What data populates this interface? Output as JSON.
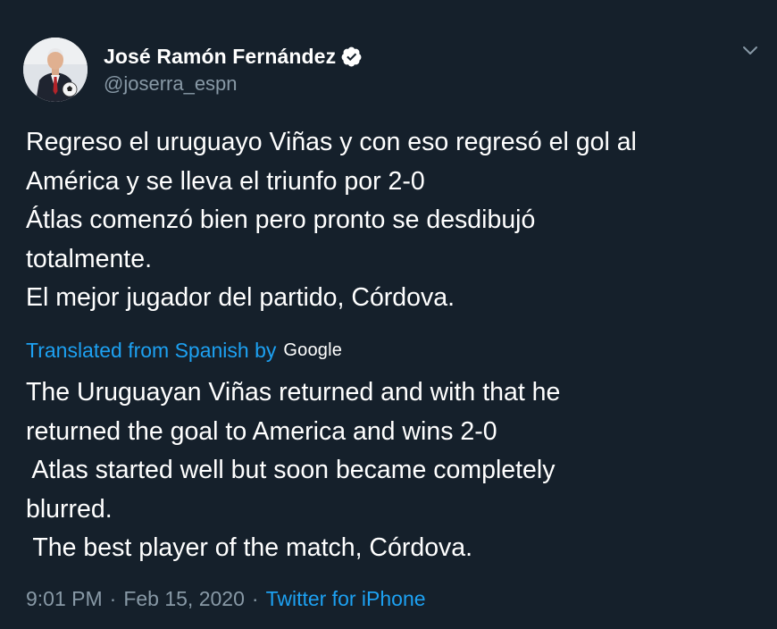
{
  "author": {
    "display_name": "José Ramón Fernández",
    "handle": "@joserra_espn",
    "verified": true,
    "avatar_icon": "profile-photo"
  },
  "tweet": {
    "lines": [
      "Regreso el uruguayo Viñas y con eso regresó el gol al",
      "América y se lleva el triunfo por 2-0",
      "Átlas comenzó bien pero pronto se desdibujó",
      "totalmente.",
      "El mejor jugador del partido, Córdova."
    ]
  },
  "translation": {
    "label": "Translated from Spanish by",
    "provider": "Google",
    "lines": [
      "The Uruguayan Viñas returned and with that he",
      "returned the goal to America and wins 2-0",
      " Atlas started well but soon became completely",
      "blurred.",
      " The best player of the match, Córdova."
    ]
  },
  "meta": {
    "time": "9:01 PM",
    "separator": "·",
    "date": "Feb 15, 2020",
    "source": "Twitter for iPhone"
  },
  "colors": {
    "background": "#15202b",
    "accent": "#1da1f2",
    "secondary_text": "#8899a6",
    "primary_text": "#ffffff"
  }
}
